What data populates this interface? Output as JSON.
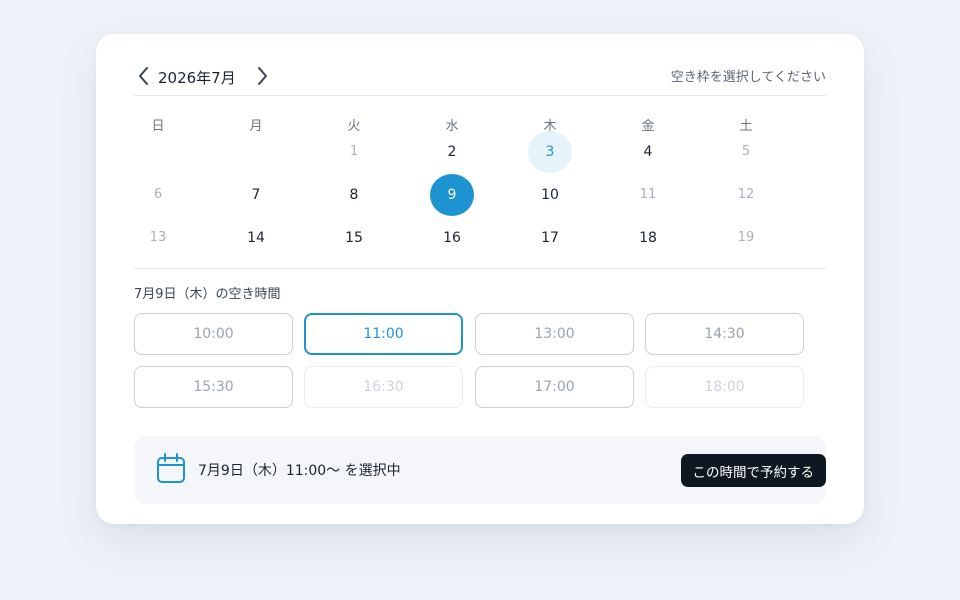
{
  "header": {
    "month_label": "2026年7月",
    "hint": "空き枠を選択してください"
  },
  "calendar": {
    "weekdays": [
      "日",
      "月",
      "火",
      "水",
      "木",
      "金",
      "土"
    ],
    "weeks": [
      [
        "",
        "",
        "1",
        "2",
        "3",
        "4",
        "5"
      ],
      [
        "6",
        "7",
        "8",
        "9",
        "10",
        "11",
        "12"
      ],
      [
        "13",
        "14",
        "15",
        "16",
        "17",
        "18",
        "19"
      ]
    ],
    "states": [
      [
        "",
        "",
        "muted",
        "active",
        "today",
        "active",
        "muted"
      ],
      [
        "muted",
        "active",
        "active",
        "selected",
        "active",
        "muted",
        "muted"
      ],
      [
        "muted",
        "active",
        "active",
        "active",
        "active",
        "active",
        "muted"
      ]
    ]
  },
  "slots": {
    "title": "7月9日（木）の空き時間",
    "items": [
      {
        "label": "10:00",
        "state": "available"
      },
      {
        "label": "11:00",
        "state": "selected"
      },
      {
        "label": "13:00",
        "state": "available"
      },
      {
        "label": "14:30",
        "state": "available"
      },
      {
        "label": "15:30",
        "state": "available"
      },
      {
        "label": "16:30",
        "state": "disabled"
      },
      {
        "label": "17:00",
        "state": "available"
      },
      {
        "label": "18:00",
        "state": "disabled"
      }
    ]
  },
  "footer": {
    "icon": "calendar-icon",
    "selection_text": "7月9日（木）11:00〜 を選択中",
    "reserve_label": "この時間で予約する"
  },
  "colors": {
    "accent": "#1e93d1",
    "today_bg": "#e5f3fb",
    "button_dark": "#0f1822"
  }
}
